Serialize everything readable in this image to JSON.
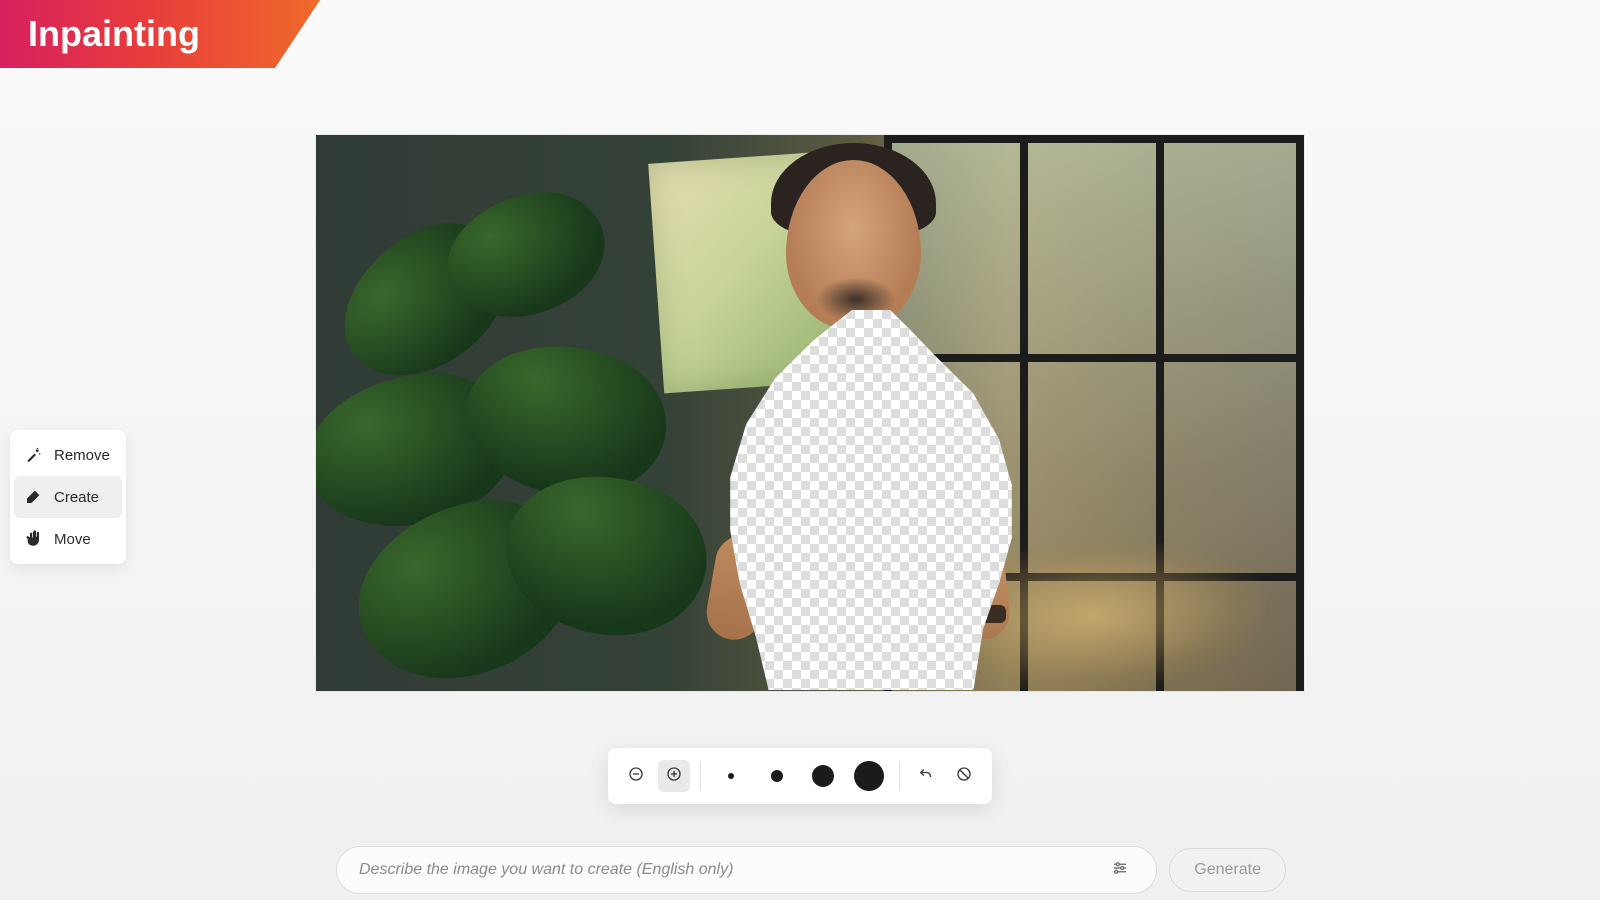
{
  "header": {
    "title": "Inpainting"
  },
  "sidebar": {
    "tools": [
      {
        "id": "remove",
        "label": "Remove",
        "icon": "wand-sparkle-icon",
        "active": false
      },
      {
        "id": "create",
        "label": "Create",
        "icon": "brush-icon",
        "active": true
      },
      {
        "id": "move",
        "label": "Move",
        "icon": "hand-icon",
        "active": false
      }
    ]
  },
  "brush_toolbar": {
    "zoom_out": "−",
    "zoom_in": "+",
    "zoom_in_active": true,
    "sizes": [
      "xs",
      "s",
      "m",
      "l"
    ],
    "selected_size": "l",
    "undo": "undo",
    "clear": "clear"
  },
  "prompt": {
    "placeholder": "Describe the image you want to create (English only)",
    "value": "",
    "settings_label": "settings",
    "generate_label": "Generate",
    "generate_enabled": false
  }
}
